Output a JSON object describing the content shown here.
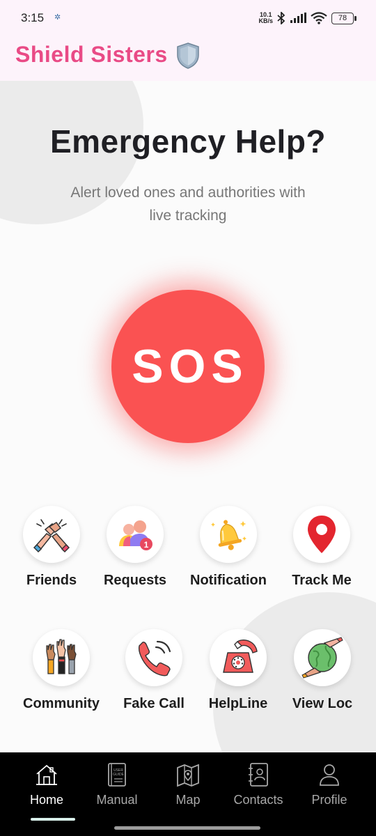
{
  "status_bar": {
    "time": "3:15",
    "net_speed_value": "10.1",
    "net_speed_unit": "KB/s",
    "battery": "78"
  },
  "app": {
    "title": "Shield Sisters",
    "brand_color": "#e94b86",
    "title_icon": "shield-icon"
  },
  "hero": {
    "headline": "Emergency Help?",
    "subtext": "Alert loved ones and authorities with live tracking"
  },
  "sos": {
    "label": "SOS",
    "color": "#fa5252"
  },
  "features": [
    {
      "label": "Friends",
      "icon": "handshake-icon"
    },
    {
      "label": "Requests",
      "icon": "friend-requests-icon",
      "badge": "1"
    },
    {
      "label": "Notification",
      "icon": "bell-icon"
    },
    {
      "label": "Track Me",
      "icon": "location-pin-icon"
    },
    {
      "label": "Community",
      "icon": "raised-hands-icon"
    },
    {
      "label": "Fake Call",
      "icon": "phone-ringing-icon"
    },
    {
      "label": "HelpLine",
      "icon": "rotary-phone-icon"
    },
    {
      "label": "View Loc",
      "icon": "globe-hands-icon"
    }
  ],
  "bottom_nav": {
    "items": [
      {
        "label": "Home",
        "icon": "home-icon",
        "active": true
      },
      {
        "label": "Manual",
        "icon": "user-guide-book-icon",
        "active": false
      },
      {
        "label": "Map",
        "icon": "map-icon",
        "active": false
      },
      {
        "label": "Contacts",
        "icon": "contacts-book-icon",
        "active": false
      },
      {
        "label": "Profile",
        "icon": "profile-icon",
        "active": false
      }
    ],
    "book_text_line1": "USER",
    "book_text_line2": "GUIDE"
  }
}
